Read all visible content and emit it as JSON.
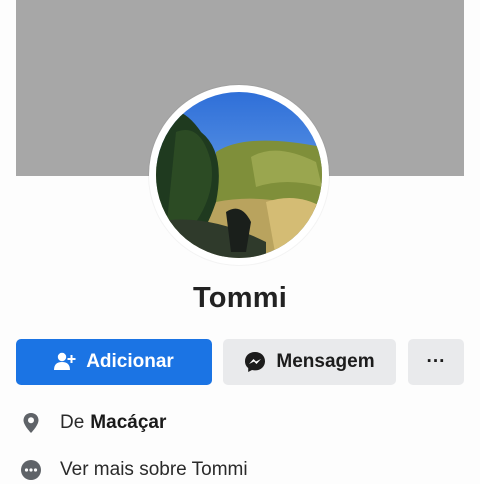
{
  "profile": {
    "name": "Tommi"
  },
  "actions": {
    "add_label": "Adicionar",
    "message_label": "Mensagem",
    "more_label": "···"
  },
  "info": {
    "from_prefix": "De",
    "from_place": "Macáçar",
    "see_more": "Ver mais sobre Tommi"
  },
  "icons": {
    "add": "add-friend-icon",
    "message": "messenger-icon",
    "location": "location-pin-icon",
    "more_info": "ellipsis-circle-icon"
  },
  "colors": {
    "primary": "#1b74e4",
    "secondary_button": "#e9eaec",
    "cover": "#a7a7a7"
  }
}
